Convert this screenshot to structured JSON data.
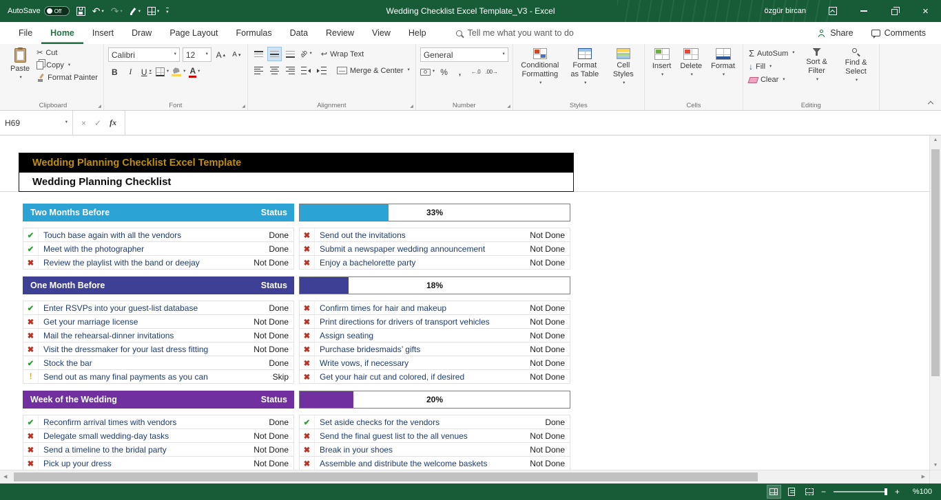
{
  "glyphs": {
    "caret": "▾",
    "launcher": "◢",
    "cut": "✂",
    "undo": "↶",
    "redo": "↷",
    "bold": "B",
    "italic": "I",
    "underline": "U",
    "letter_a": "A",
    "up_small": "▴",
    "down_small": "▾",
    "orientation": "ab",
    "wrap": "↩",
    "percent": "%",
    "comma": ",",
    "increase_decimal": "←.0",
    "decrease_decimal": ".00→",
    "sigma": "Σ",
    "fill_down": "↓",
    "close": "×",
    "cancel": "×",
    "enter": "✓",
    "fx": "fx",
    "scroll_up": "▲",
    "scroll_down": "▼",
    "scroll_left": "◀",
    "scroll_right": "▶",
    "zoom_out": "−",
    "zoom_in": "+"
  },
  "titlebar": {
    "autosave_label": "AutoSave",
    "autosave_state": "Off",
    "title": "Wedding Checklist Excel Template_V3  -  Excel",
    "user": "özgür bircan"
  },
  "tabs": {
    "items": [
      "File",
      "Home",
      "Insert",
      "Draw",
      "Page Layout",
      "Formulas",
      "Data",
      "Review",
      "View",
      "Help"
    ],
    "active": "Home",
    "tellme": "Tell me what you want to do",
    "share": "Share",
    "comments": "Comments"
  },
  "ribbon": {
    "clipboard": {
      "label": "Clipboard",
      "paste": "Paste",
      "cut": "Cut",
      "copy": "Copy",
      "format_painter": "Format Painter"
    },
    "font": {
      "label": "Font",
      "family": "Calibri",
      "size": "12"
    },
    "alignment": {
      "label": "Alignment",
      "wrap_text": "Wrap Text",
      "merge_center": "Merge & Center"
    },
    "number": {
      "label": "Number",
      "format": "General"
    },
    "styles": {
      "label": "Styles",
      "conditional_formatting": "Conditional Formatting",
      "format_as_table": "Format as Table",
      "cell_styles": "Cell Styles"
    },
    "cells": {
      "label": "Cells",
      "insert": "Insert",
      "delete": "Delete",
      "format": "Format"
    },
    "editing": {
      "label": "Editing",
      "autosum": "AutoSum",
      "fill": "Fill",
      "clear": "Clear",
      "sort_filter": "Sort & Filter",
      "find_select": "Find & Select"
    }
  },
  "formula_bar": {
    "name_box": "H69"
  },
  "sheet": {
    "banner_title": "Wedding Planning Checklist Excel Template",
    "subtitle": "Wedding Planning Checklist",
    "status_header": "Status",
    "state_glyphs": {
      "done": "✔",
      "notdone": "✖",
      "skip": "!"
    },
    "state_colors": {
      "done": "#2aa12e",
      "notdone": "#bb3322",
      "skip": "#e2a234"
    },
    "sections": [
      {
        "name": "Two Months Before",
        "color": "#2ba3d4",
        "progress": 33,
        "progress_label": "33%",
        "left": [
          {
            "state": "done",
            "text": "Touch base again with all the vendors",
            "status": "Done"
          },
          {
            "state": "done",
            "text": "Meet with the photographer",
            "status": "Done"
          },
          {
            "state": "notdone",
            "text": "Review the playlist with the band or deejay",
            "status": "Not Done"
          }
        ],
        "right": [
          {
            "state": "notdone",
            "text": "Send out the invitations",
            "status": "Not Done"
          },
          {
            "state": "notdone",
            "text": "Submit a newspaper wedding announcement",
            "status": "Not Done"
          },
          {
            "state": "notdone",
            "text": "Enjoy a bachelorette party",
            "status": "Not Done"
          }
        ]
      },
      {
        "name": "One Month Before",
        "color": "#3e4095",
        "progress": 18,
        "progress_label": "18%",
        "left": [
          {
            "state": "done",
            "text": "Enter RSVPs into your guest-list database",
            "status": "Done"
          },
          {
            "state": "notdone",
            "text": "Get your marriage license",
            "status": "Not Done"
          },
          {
            "state": "notdone",
            "text": "Mail the rehearsal-dinner invitations",
            "status": "Not Done"
          },
          {
            "state": "notdone",
            "text": "Visit the dressmaker for your last dress fitting",
            "status": "Not Done"
          },
          {
            "state": "done",
            "text": "Stock the bar",
            "status": "Done"
          },
          {
            "state": "skip",
            "text": "Send out as many final payments as you can",
            "status": "Skip"
          }
        ],
        "right": [
          {
            "state": "notdone",
            "text": "Confirm times for hair and makeup",
            "status": "Not Done"
          },
          {
            "state": "notdone",
            "text": "Print directions for drivers of transport vehicles",
            "status": "Not Done"
          },
          {
            "state": "notdone",
            "text": "Assign seating",
            "status": "Not Done"
          },
          {
            "state": "notdone",
            "text": "Purchase bridesmaids’ gifts",
            "status": "Not Done"
          },
          {
            "state": "notdone",
            "text": "Write vows, if necessary",
            "status": "Not Done"
          },
          {
            "state": "notdone",
            "text": "Get your hair cut and colored, if desired",
            "status": "Not Done"
          }
        ]
      },
      {
        "name": "Week of the Wedding",
        "color": "#7030a0",
        "progress": 20,
        "progress_label": "20%",
        "left": [
          {
            "state": "done",
            "text": "Reconfirm arrival times with vendors",
            "status": "Done"
          },
          {
            "state": "notdone",
            "text": "Delegate small wedding-day tasks",
            "status": "Not Done"
          },
          {
            "state": "notdone",
            "text": "Send a timeline to the bridal party",
            "status": "Not Done"
          },
          {
            "state": "notdone",
            "text": "Pick up your dress",
            "status": "Not Done"
          }
        ],
        "right": [
          {
            "state": "done",
            "text": "Set aside checks for the vendors",
            "status": "Done"
          },
          {
            "state": "notdone",
            "text": "Send the final guest list to the all venues",
            "status": "Not Done"
          },
          {
            "state": "notdone",
            "text": "Break in your shoes",
            "status": "Not Done"
          },
          {
            "state": "notdone",
            "text": "Assemble and distribute the welcome baskets",
            "status": "Not Done"
          }
        ]
      }
    ]
  },
  "status_bar": {
    "zoom": "%100"
  }
}
